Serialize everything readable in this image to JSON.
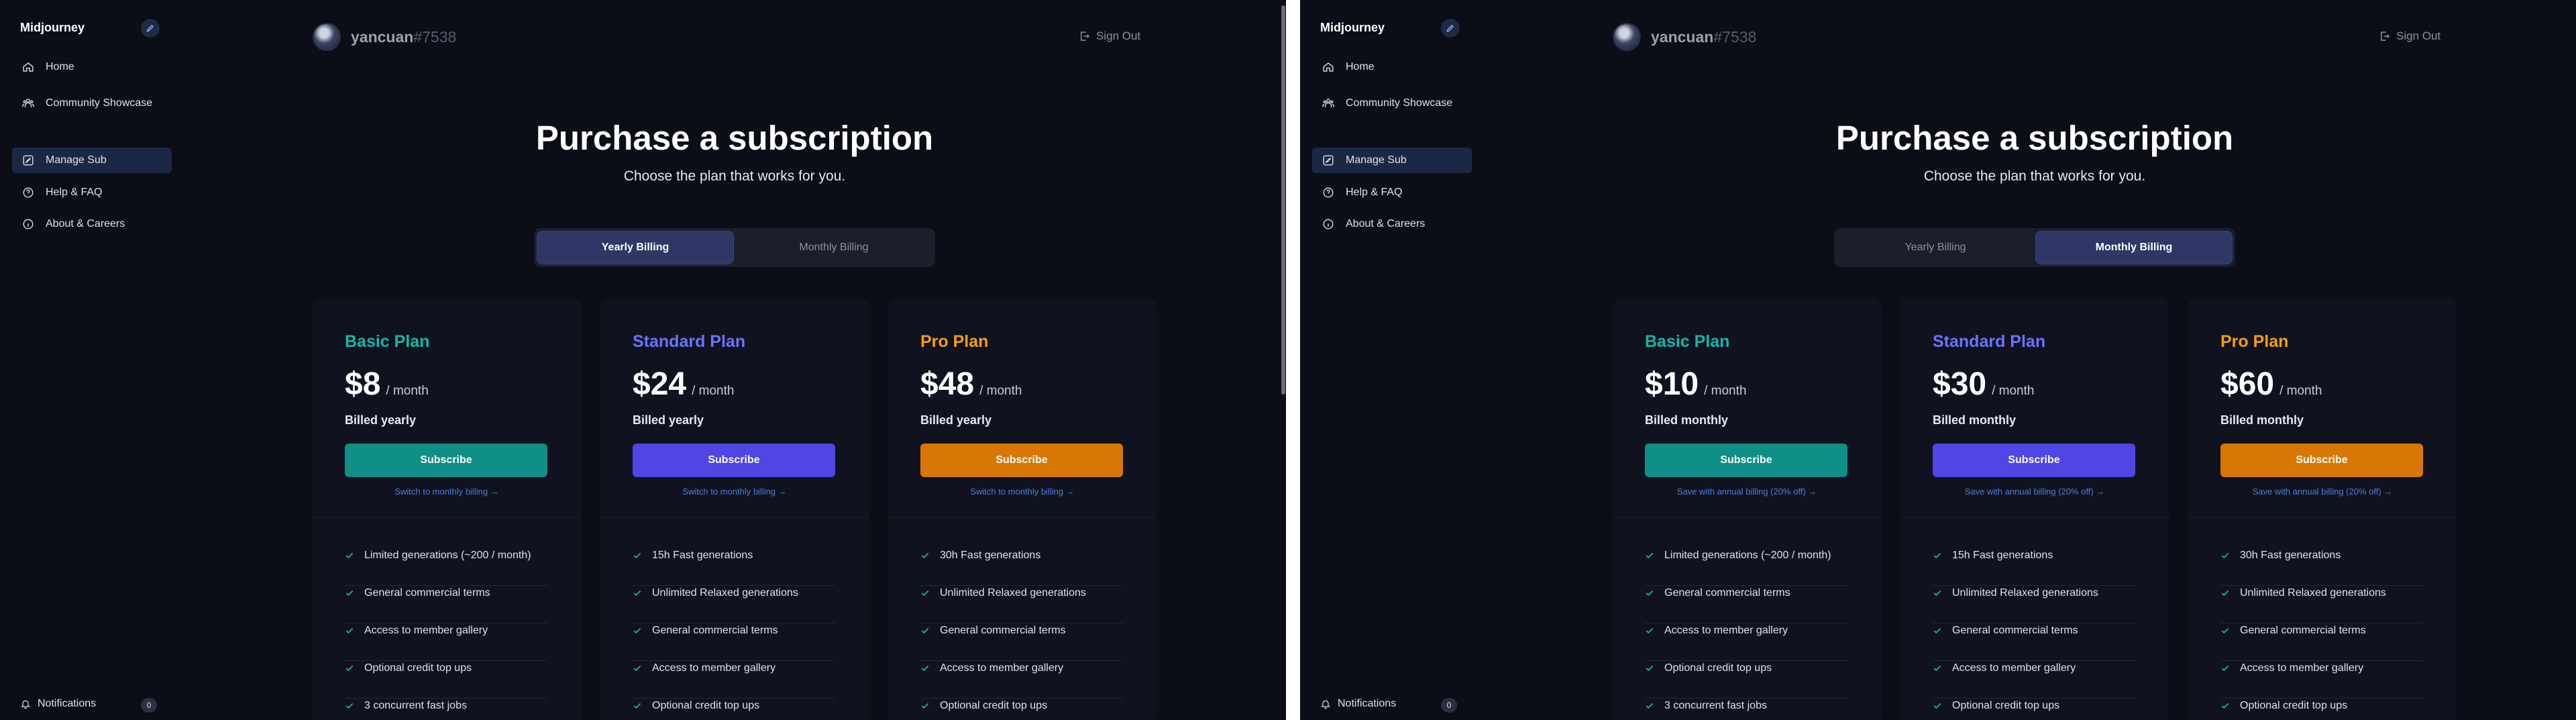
{
  "colors": {
    "basic": "#14b8a6",
    "standard": "#6c72ff",
    "pro": "#f59e0b",
    "basic_button": "#0f8f85",
    "standard_button": "#4f46e5",
    "pro_button": "#d97706"
  },
  "panes": [
    {
      "sidebar": {
        "brand": "Midjourney",
        "items": [
          {
            "label": "Home",
            "icon": "home-icon"
          },
          {
            "label": "Community Showcase",
            "icon": "community-icon"
          },
          {
            "label": "Manage Sub",
            "icon": "edit-icon",
            "active": true
          },
          {
            "label": "Help & FAQ",
            "icon": "help-icon"
          },
          {
            "label": "About & Careers",
            "icon": "info-icon"
          }
        ],
        "notifications_label": "Notifications",
        "notifications_count": "0"
      },
      "header": {
        "username": "yancuan",
        "discriminator": "#7538",
        "sign_out": "Sign Out"
      },
      "main": {
        "title": "Purchase a subscription",
        "subtitle": "Choose the plan that works for you.",
        "toggle": {
          "yearly": "Yearly Billing",
          "monthly": "Monthly Billing",
          "selected": "yearly"
        },
        "plans": [
          {
            "name": "Basic Plan",
            "price": "$8",
            "per": "/ month",
            "billed": "Billed yearly",
            "button": "Subscribe",
            "switch": "Switch to monthly billing →",
            "features": [
              "Limited generations (~200 / month)",
              "General commercial terms",
              "Access to member gallery",
              "Optional credit top ups",
              "3 concurrent fast jobs"
            ]
          },
          {
            "name": "Standard Plan",
            "price": "$24",
            "per": "/ month",
            "billed": "Billed yearly",
            "button": "Subscribe",
            "switch": "Switch to monthly billing →",
            "features": [
              "15h Fast generations",
              "Unlimited Relaxed generations",
              "General commercial terms",
              "Access to member gallery",
              "Optional credit top ups"
            ]
          },
          {
            "name": "Pro Plan",
            "price": "$48",
            "per": "/ month",
            "billed": "Billed yearly",
            "button": "Subscribe",
            "switch": "Switch to monthly billing →",
            "features": [
              "30h Fast generations",
              "Unlimited Relaxed generations",
              "General commercial terms",
              "Access to member gallery",
              "Optional credit top ups"
            ]
          }
        ]
      }
    },
    {
      "sidebar": {
        "brand": "Midjourney",
        "items": [
          {
            "label": "Home",
            "icon": "home-icon"
          },
          {
            "label": "Community Showcase",
            "icon": "community-icon"
          },
          {
            "label": "Manage Sub",
            "icon": "edit-icon",
            "active": true
          },
          {
            "label": "Help & FAQ",
            "icon": "help-icon"
          },
          {
            "label": "About & Careers",
            "icon": "info-icon"
          }
        ],
        "notifications_label": "Notifications",
        "notifications_count": "0"
      },
      "header": {
        "username": "yancuan",
        "discriminator": "#7538",
        "sign_out": "Sign Out"
      },
      "main": {
        "title": "Purchase a subscription",
        "subtitle": "Choose the plan that works for you.",
        "toggle": {
          "yearly": "Yearly Billing",
          "monthly": "Monthly Billing",
          "selected": "monthly"
        },
        "plans": [
          {
            "name": "Basic Plan",
            "price": "$10",
            "per": "/ month",
            "billed": "Billed monthly",
            "button": "Subscribe",
            "switch": "Save with annual billing (20% off) →",
            "features": [
              "Limited generations (~200 / month)",
              "General commercial terms",
              "Access to member gallery",
              "Optional credit top ups",
              "3 concurrent fast jobs"
            ]
          },
          {
            "name": "Standard Plan",
            "price": "$30",
            "per": "/ month",
            "billed": "Billed monthly",
            "button": "Subscribe",
            "switch": "Save with annual billing (20% off) →",
            "features": [
              "15h Fast generations",
              "Unlimited Relaxed generations",
              "General commercial terms",
              "Access to member gallery",
              "Optional credit top ups"
            ]
          },
          {
            "name": "Pro Plan",
            "price": "$60",
            "per": "/ month",
            "billed": "Billed monthly",
            "button": "Subscribe",
            "switch": "Save with annual billing (20% off) →",
            "features": [
              "30h Fast generations",
              "Unlimited Relaxed generations",
              "General commercial terms",
              "Access to member gallery",
              "Optional credit top ups"
            ]
          }
        ]
      }
    }
  ]
}
